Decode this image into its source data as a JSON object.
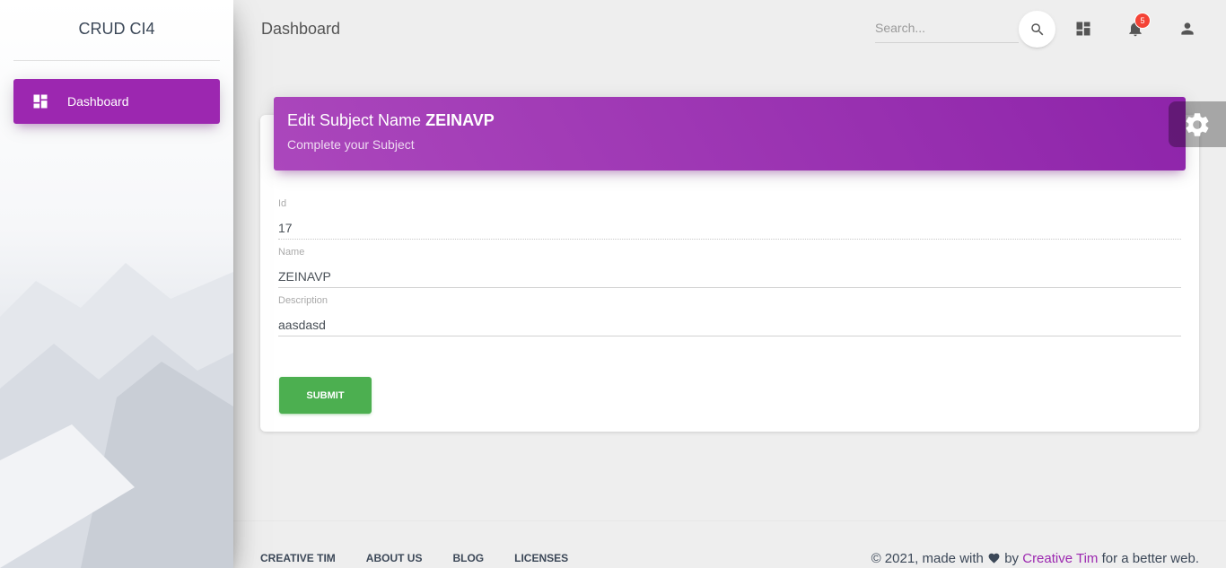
{
  "sidebar": {
    "logo_text": "CRUD CI4",
    "items": [
      {
        "label": "Dashboard",
        "icon": "dashboard-icon",
        "active": true
      }
    ]
  },
  "navbar": {
    "page_title": "Dashboard",
    "search_placeholder": "Search...",
    "notifications_count": "5"
  },
  "card": {
    "title_prefix": "Edit Subject Name",
    "title_name": "ZEINAVP",
    "subtitle": "Complete your Subject"
  },
  "form": {
    "fields": [
      {
        "label": "Id",
        "value": "17"
      },
      {
        "label": "Name",
        "value": "ZEINAVP"
      },
      {
        "label": "Description",
        "value": "aasdasd"
      }
    ],
    "submit_label": "SUBMIT"
  },
  "footer": {
    "links": [
      "CREATIVE TIM",
      "ABOUT US",
      "BLOG",
      "LICENSES"
    ],
    "copyright_prefix": "© 2021, made with",
    "copyright_by": "by",
    "copyright_link": "Creative Tim",
    "copyright_suffix": "for a better web."
  },
  "colors": {
    "primary": "#9c27b0",
    "success": "#4caf50",
    "danger": "#f44336",
    "background": "#eeeeee"
  }
}
